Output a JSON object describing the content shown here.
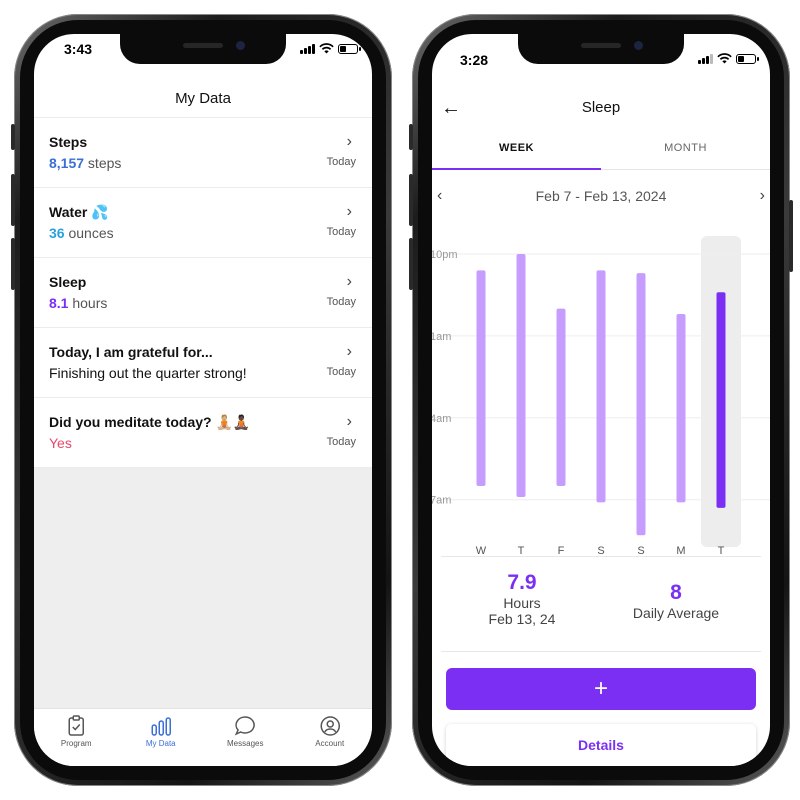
{
  "left_phone": {
    "status": {
      "time": "3:43"
    },
    "title": "My Data",
    "items": [
      {
        "title": "Steps",
        "value": "8,157",
        "unit": " steps",
        "value_color": "#3b6fd6",
        "date": "Today"
      },
      {
        "title": "Water 💦",
        "value": "36",
        "unit": " ounces",
        "value_color": "#29a3e0",
        "date": "Today"
      },
      {
        "title": "Sleep",
        "value": "8.1",
        "unit": " hours",
        "value_color": "#7b2ff2",
        "date": "Today"
      },
      {
        "title": "Today, I am grateful for...",
        "text": "Finishing out the quarter strong!",
        "date": "Today"
      },
      {
        "title": "Did you meditate today? 🧘🏼🧘🏿",
        "answer": "Yes",
        "answer_color": "#e8476c",
        "date": "Today"
      }
    ],
    "tabbar": [
      {
        "label": "Program",
        "icon": "clipboard-icon"
      },
      {
        "label": "My Data",
        "icon": "bar-chart-icon",
        "active": true
      },
      {
        "label": "Messages",
        "icon": "chat-bubble-icon"
      },
      {
        "label": "Account",
        "icon": "user-circle-icon"
      }
    ]
  },
  "right_phone": {
    "status": {
      "time": "3:28"
    },
    "title": "Sleep",
    "tabs": [
      "WEEK",
      "MONTH"
    ],
    "active_tab": "WEEK",
    "date_range": "Feb 7 - Feb 13, 2024",
    "summary": {
      "last_value": "7.9",
      "last_unit": "Hours",
      "last_date": "Feb 13, 24",
      "avg_value": "8",
      "avg_label": "Daily Average"
    },
    "add_label": "+",
    "details_label": "Details"
  },
  "chart_data": {
    "type": "bar",
    "title": "",
    "subtitle": "",
    "orientation": "floating-range",
    "categories": [
      "W",
      "T",
      "F",
      "S",
      "S",
      "M",
      "T"
    ],
    "y_ticks": [
      "10pm",
      "1am",
      "4am",
      "7am"
    ],
    "ylim_hours_after_10pm": [
      0,
      10
    ],
    "series": [
      {
        "start_hours_after_10pm": [
          0.6,
          0.0,
          2.0,
          0.6,
          0.7,
          2.2,
          1.4
        ],
        "end_hours_after_10pm": [
          8.5,
          8.9,
          8.5,
          9.1,
          10.3,
          9.1,
          9.3
        ]
      }
    ],
    "highlighted_index": 6,
    "colors": {
      "bar": "#c79cff",
      "highlight_bar": "#7b2ff2",
      "highlight_bg": "#ededed",
      "grid": "#eeeeee"
    },
    "grid": true
  }
}
